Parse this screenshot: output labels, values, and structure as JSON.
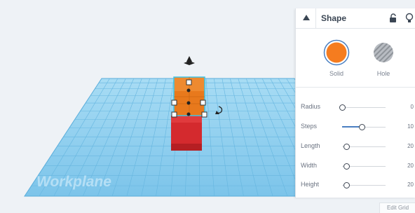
{
  "workplane": {
    "label": "Workplane"
  },
  "panel": {
    "title": "Shape",
    "solid": {
      "label": "Solid",
      "color": "#f57c1f"
    },
    "hole": {
      "label": "Hole"
    },
    "properties": [
      {
        "label": "Radius",
        "value": "0",
        "fraction": 0.0
      },
      {
        "label": "Steps",
        "value": "10",
        "fraction": 0.45
      },
      {
        "label": "Length",
        "value": "20",
        "fraction": 0.1
      },
      {
        "label": "Width",
        "value": "20",
        "fraction": 0.1
      },
      {
        "label": "Height",
        "value": "20",
        "fraction": 0.1
      }
    ]
  },
  "edit_grid": {
    "label": "Edit Grid"
  },
  "colors": {
    "grid_fill": "#8ecfee",
    "grid_line": "#5aaedb",
    "box_orange": "#e8791c",
    "box_red": "#d42a2e",
    "accent": "#4a7fc1"
  },
  "icons": [
    "view-cube-arrows-icon",
    "rotate-icon",
    "collapse-triangle-icon",
    "lock-icon",
    "lightbulb-icon"
  ]
}
